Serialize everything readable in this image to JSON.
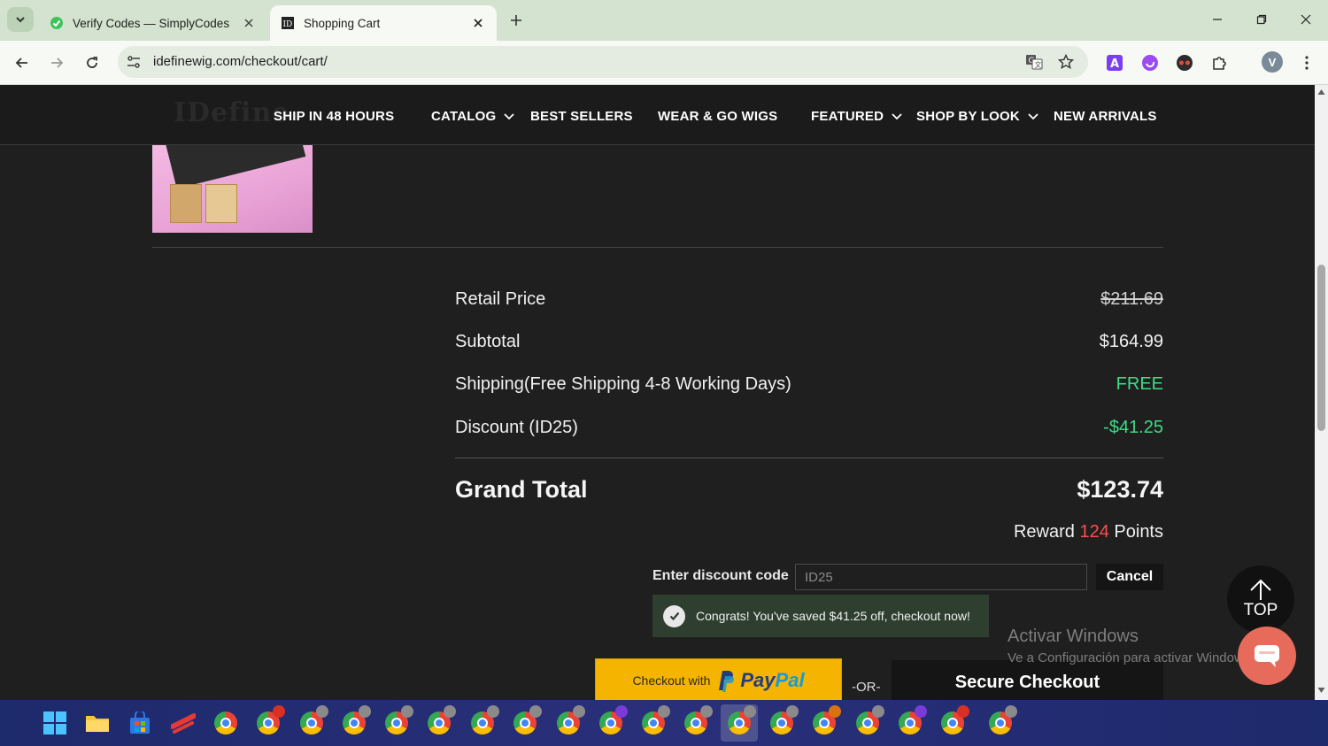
{
  "browser": {
    "tabs": [
      {
        "title": "Verify Codes — SimplyCodes",
        "active": false
      },
      {
        "title": "Shopping Cart",
        "active": true
      }
    ],
    "url": "idefinewig.com/checkout/cart/",
    "profile_initial": "V"
  },
  "site": {
    "logo": "IDefine",
    "nav": [
      {
        "label": "SHIP IN 48 HOURS",
        "has_dropdown": false
      },
      {
        "label": "CATALOG",
        "has_dropdown": true
      },
      {
        "label": "BEST SELLERS",
        "has_dropdown": false
      },
      {
        "label": "WEAR & GO WIGS",
        "has_dropdown": false
      },
      {
        "label": "FEATURED",
        "has_dropdown": true
      },
      {
        "label": "SHOP BY LOOK",
        "has_dropdown": true
      },
      {
        "label": "NEW ARRIVALS",
        "has_dropdown": false
      }
    ]
  },
  "summary": {
    "retail_label": "Retail Price",
    "retail_value": "$211.69",
    "subtotal_label": "Subtotal",
    "subtotal_value": "$164.99",
    "shipping_label": "Shipping(Free Shipping 4-8 Working Days)",
    "shipping_value": "FREE",
    "discount_label": "Discount (ID25)",
    "discount_value": "-$41.25",
    "grand_total_label": "Grand Total",
    "grand_total_value": "$123.74",
    "reward_prefix": "Reward",
    "reward_points": "124",
    "reward_suffix": "Points"
  },
  "discount_form": {
    "label": "Enter discount code",
    "value": "ID25",
    "cancel_label": "Cancel",
    "success_message": "Congrats! You've saved $41.25 off, checkout now!"
  },
  "checkout": {
    "paypal_text": "Checkout with",
    "paypal_logo_pay": "Pay",
    "paypal_logo_pal": "Pal",
    "or_text": "-OR-",
    "secure_label": "Secure Checkout"
  },
  "back_to_top_label": "TOP",
  "watermark": {
    "line1": "Activar Windows",
    "line2": "Ve a Configuración para activar Windows."
  },
  "colors": {
    "page_bg": "#1f1f1f",
    "accent_green": "#3ddc84",
    "reward_red": "#ff4d4d",
    "paypal_yellow": "#f5b400"
  }
}
